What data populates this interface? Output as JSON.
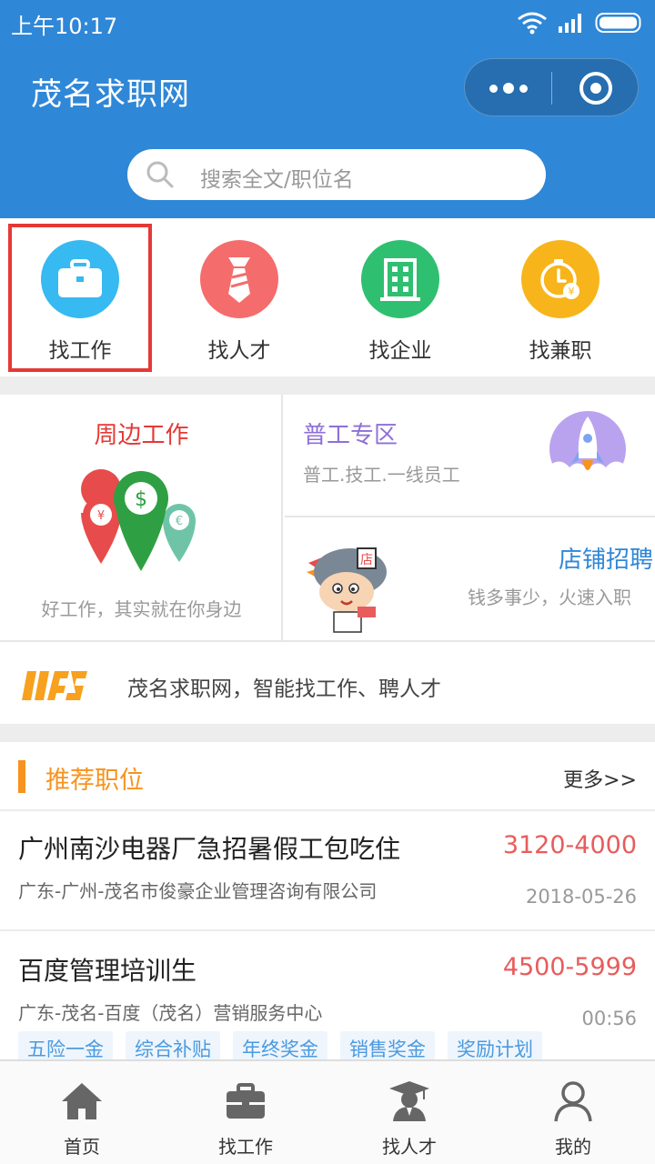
{
  "status_bar": {
    "time": "上午10:17"
  },
  "header": {
    "title": "茂名求职网",
    "search": {
      "placeholder": "搜索全文/职位名"
    }
  },
  "categories": [
    {
      "label": "找工作",
      "color": "#37b9f1",
      "icon": "briefcase-icon"
    },
    {
      "label": "找人才",
      "color": "#f56c6c",
      "icon": "tie-icon"
    },
    {
      "label": "找企业",
      "color": "#2fbf71",
      "icon": "building-icon"
    },
    {
      "label": "找兼职",
      "color": "#f7b51b",
      "icon": "clock-coin-icon"
    }
  ],
  "features": {
    "nearby": {
      "title": "周边工作",
      "subtitle": "好工作，其实就在你身边"
    },
    "general": {
      "title": "普工专区",
      "subtitle": "普工.技工.一线员工"
    },
    "shop": {
      "title": "店铺招聘",
      "subtitle": "钱多事少，火速入职"
    }
  },
  "notice": {
    "text": "茂名求职网，智能找工作、聘人才"
  },
  "recommended": {
    "title": "推荐职位",
    "more": "更多>>",
    "jobs": [
      {
        "title": "广州南沙电器厂急招暑假工包吃住",
        "company": "广东-广州-茂名市俊豪企业管理咨询有限公司",
        "salary": "3120-4000",
        "date": "2018-05-26"
      },
      {
        "title": "百度管理培训生",
        "company": "广东-茂名-百度（茂名）营销服务中心",
        "salary": "4500-5999",
        "date": "00:56",
        "tags": [
          "五险一金",
          "综合补贴",
          "年终奖金",
          "销售奖金",
          "奖励计划"
        ]
      }
    ]
  },
  "tabbar": [
    {
      "label": "首页",
      "icon": "home-icon"
    },
    {
      "label": "找工作",
      "icon": "briefcase-icon"
    },
    {
      "label": "找人才",
      "icon": "graduate-icon"
    },
    {
      "label": "我的",
      "icon": "user-icon"
    }
  ],
  "colors": {
    "brand_blue": "#2f87d7",
    "highlight_red": "#e53935",
    "accent_orange": "#f7931e",
    "salary_red": "#e85c5c"
  }
}
